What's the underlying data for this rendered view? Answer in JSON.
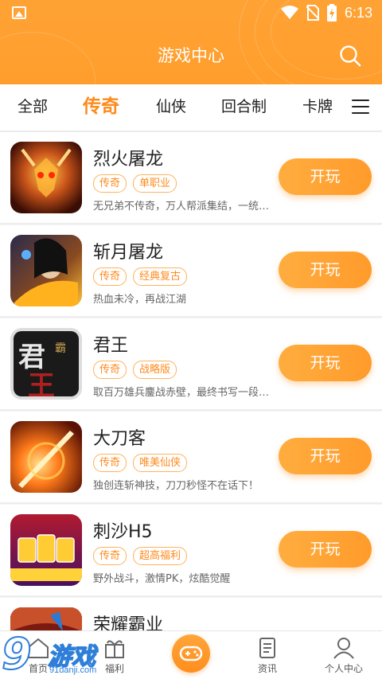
{
  "status_bar": {
    "time": "6:13"
  },
  "header": {
    "title": "游戏中心"
  },
  "tabs": [
    {
      "label": "全部",
      "active": false
    },
    {
      "label": "传奇",
      "active": true
    },
    {
      "label": "仙侠",
      "active": false
    },
    {
      "label": "回合制",
      "active": false
    },
    {
      "label": "卡牌",
      "active": false
    }
  ],
  "play_label": "开玩",
  "games": [
    {
      "name": "烈火屠龙",
      "tags": [
        "传奇",
        "单职业"
      ],
      "desc": "无兄弟不传奇，万人帮派集结，一统…",
      "icon": "dragon-icon"
    },
    {
      "name": "斩月屠龙",
      "tags": [
        "传奇",
        "经典复古"
      ],
      "desc": "热血未冷，再战江湖",
      "icon": "warrior-icon"
    },
    {
      "name": "君王",
      "tags": [
        "传奇",
        "战略版"
      ],
      "desc": "取百万雄兵鏖战赤壁，最终书写一段…",
      "icon": "king-icon"
    },
    {
      "name": "大刀客",
      "tags": [
        "传奇",
        "唯美仙侠"
      ],
      "desc": "独创连斩神技，刀刀秒怪不在话下！",
      "icon": "sword-icon"
    },
    {
      "name": "刺沙H5",
      "tags": [
        "传奇",
        "超高福利"
      ],
      "desc": "野外战斗，激情PK，炫酷觉醒",
      "icon": "card-icon"
    },
    {
      "name": "荣耀霸业",
      "tags": [],
      "desc": "",
      "icon": "glory-icon"
    }
  ],
  "bottom_nav": [
    {
      "label": "首页",
      "icon": "home-icon"
    },
    {
      "label": "福利",
      "icon": "gift-icon"
    },
    {
      "label": "",
      "icon": "gamepad-icon"
    },
    {
      "label": "资讯",
      "icon": "news-icon"
    },
    {
      "label": "个人中心",
      "icon": "user-icon"
    }
  ],
  "watermark": {
    "logo": "9",
    "text": "游戏",
    "url": "91danji.com"
  },
  "colors": {
    "accent": "#ff9e2c",
    "tag_border": "#ffb25b",
    "tag_text": "#ff8a1c"
  }
}
